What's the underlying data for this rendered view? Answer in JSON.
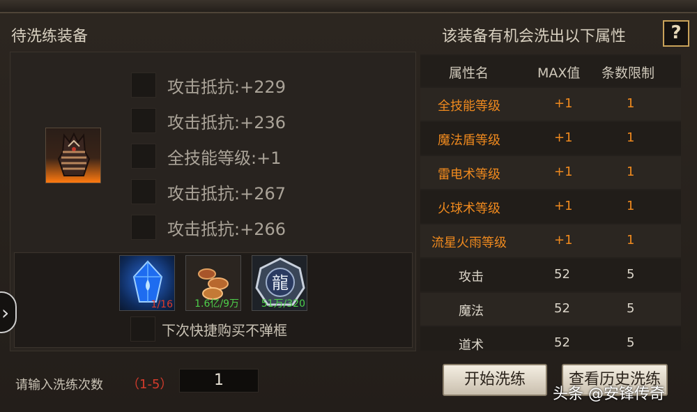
{
  "header": {
    "left_title": "待洗练装备",
    "right_title": "该装备有机会洗出以下属性",
    "help_label": "?"
  },
  "equipment": {
    "icon": "dark-gauntlet-icon",
    "attributes": [
      {
        "text": "攻击抵抗:+229"
      },
      {
        "text": "攻击抵抗:+236"
      },
      {
        "text": "全技能等级:+1"
      },
      {
        "text": "攻击抵抗:+267"
      },
      {
        "text": "攻击抵抗:+266"
      }
    ]
  },
  "materials": [
    {
      "icon": "blue-crystal-icon",
      "count": "1/16",
      "count_color": "#e03b2a"
    },
    {
      "icon": "gold-coins-icon",
      "count": "1.6亿/9万",
      "count_color": "#4ed04a"
    },
    {
      "icon": "dragon-medal-icon",
      "count": "51万/320",
      "count_color": "#4ed04a"
    }
  ],
  "quick_buy_label": "下次快捷购买不弹框",
  "table": {
    "headers": [
      "属性名",
      "MAX值",
      "条数限制"
    ],
    "rows": [
      {
        "name": "全技能等级",
        "max": "+1",
        "limit": "1",
        "highlight": true
      },
      {
        "name": "魔法盾等级",
        "max": "+1",
        "limit": "1",
        "highlight": true
      },
      {
        "name": "雷电术等级",
        "max": "+1",
        "limit": "1",
        "highlight": true
      },
      {
        "name": "火球术等级",
        "max": "+1",
        "limit": "1",
        "highlight": true
      },
      {
        "name": "流星火雨等级",
        "max": "+1",
        "limit": "1",
        "highlight": true
      },
      {
        "name": "攻击",
        "max": "52",
        "limit": "5",
        "highlight": false
      },
      {
        "name": "魔法",
        "max": "52",
        "limit": "5",
        "highlight": false
      },
      {
        "name": "道术",
        "max": "52",
        "limit": "5",
        "highlight": false
      }
    ]
  },
  "footer": {
    "input_label": "请输入洗练次数",
    "input_range": "（1-5）",
    "input_value": "1",
    "start_button": "开始洗练",
    "history_button": "查看历史洗练"
  },
  "watermark": "头条 @安锋传奇",
  "colors": {
    "accent_orange": "#f08a1e",
    "warn_red": "#e03b2a",
    "ok_green": "#4ed04a",
    "help_border": "#c9a35a"
  }
}
